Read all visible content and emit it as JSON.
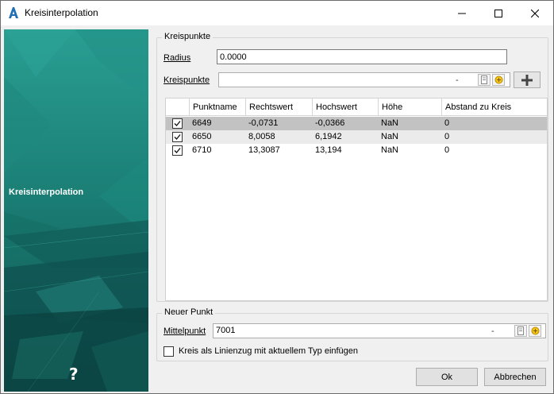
{
  "window": {
    "title": "Kreisinterpolation",
    "icon": "autocad-a-icon",
    "controls": [
      "minimize-icon",
      "maximize-icon",
      "close-icon"
    ]
  },
  "banner": {
    "title": "Kreisinterpolation",
    "help_label": "?"
  },
  "kreispunkte_group": {
    "legend": "Kreispunkte",
    "radius_label": "Radius",
    "radius_value": "0.0000",
    "kreispunkte_label": "Kreispunkte",
    "kreispunkte_value": "",
    "combo_dash": "-",
    "add_icon": "plus-icon"
  },
  "grid": {
    "columns": [
      "Punktname",
      "Rechtswert",
      "Hochswert",
      "Höhe",
      "Abstand zu Kreis"
    ],
    "rows": [
      {
        "checked": true,
        "punktname": "6649",
        "rechtswert": "-0,0731",
        "hochswert": "-0,0366",
        "hoehe": "NaN",
        "abstand": "0"
      },
      {
        "checked": true,
        "punktname": "6650",
        "rechtswert": "8,0058",
        "hochswert": "6,1942",
        "hoehe": "NaN",
        "abstand": "0"
      },
      {
        "checked": true,
        "punktname": "6710",
        "rechtswert": "13,3087",
        "hochswert": "13,194",
        "hoehe": "NaN",
        "abstand": "0"
      }
    ]
  },
  "neuer_punkt_group": {
    "legend": "Neuer Punkt",
    "mittelpunkt_label": "Mittelpunkt",
    "mittelpunkt_value": "7001",
    "combo_dash": "-",
    "checkbox_label": "Kreis als Linienzug mit aktuellem Typ einfügen",
    "checkbox_checked": false
  },
  "footer": {
    "ok_label": "Ok",
    "cancel_label": "Abbrechen"
  }
}
